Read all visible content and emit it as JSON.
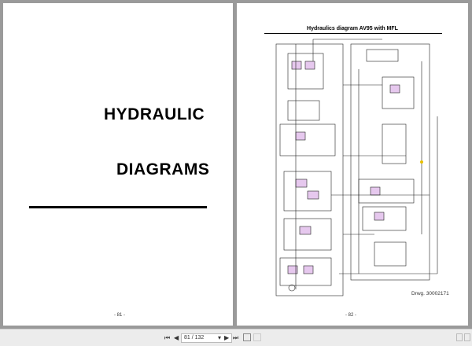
{
  "left_page": {
    "heading1": "HYDRAULIC",
    "heading2": "DIAGRAMS",
    "page_number": "- 81 -"
  },
  "right_page": {
    "title": "Hydraulics diagram AV95 with MFL",
    "drawing_number": "Drwg. 30002171",
    "page_number": "- 82 -"
  },
  "toolbar": {
    "page_input": "81 / 132",
    "first_icon": "⏮",
    "prev_icon": "◀",
    "next_icon": "▶",
    "last_icon": "⏭",
    "dropdown_icon": "▾"
  }
}
